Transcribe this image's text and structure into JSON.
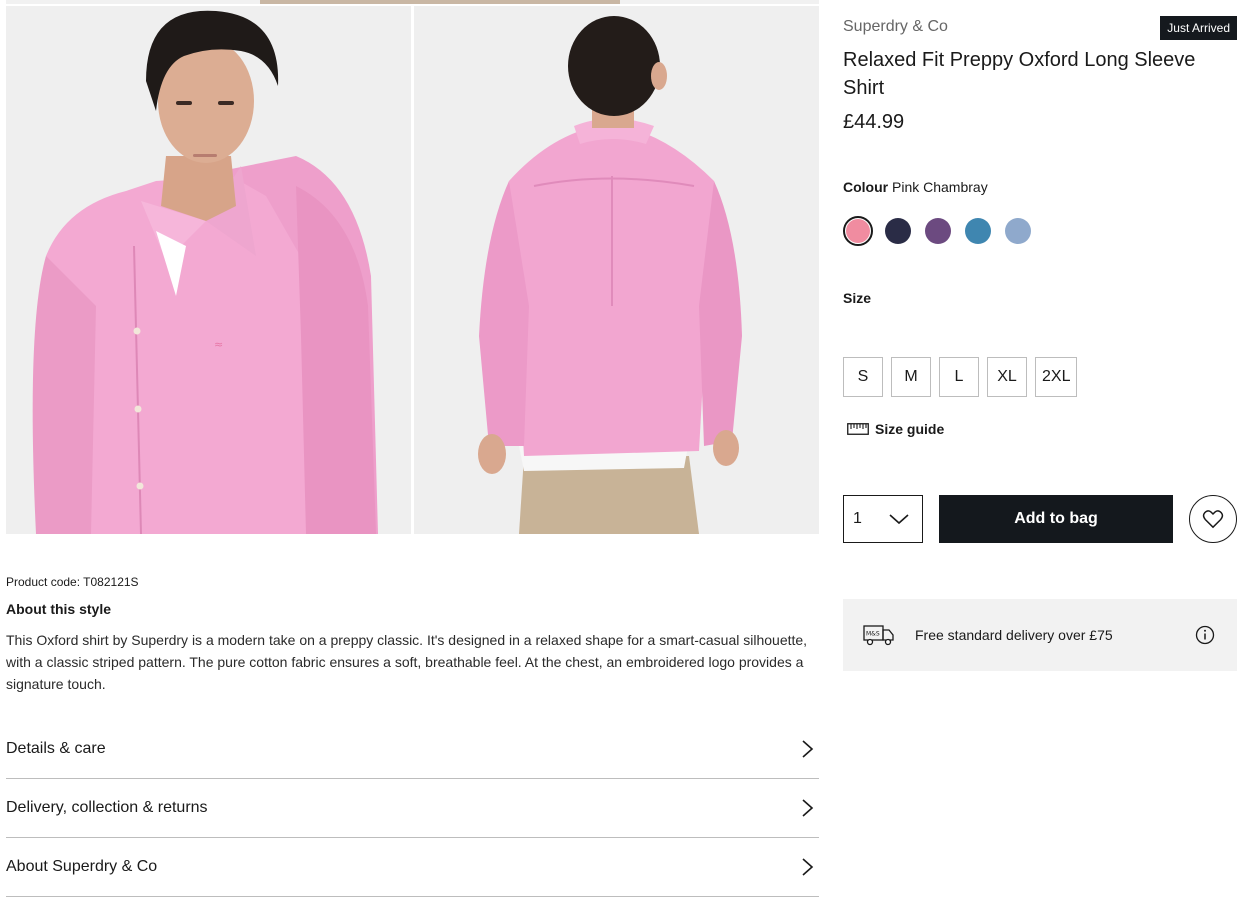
{
  "gallery": {
    "images": [
      {
        "label": "Front view of model wearing pink oxford shirt"
      },
      {
        "label": "Back view of model wearing pink oxford shirt"
      }
    ]
  },
  "product": {
    "brand": "Superdry & Co",
    "badge": "Just Arrived",
    "title": "Relaxed Fit Preppy Oxford Long Sleeve Shirt",
    "price": "£44.99",
    "code": "Product code: T082121S"
  },
  "colour": {
    "label": "Colour",
    "selected": "Pink Chambray",
    "swatches": [
      {
        "color": "#f08ca0",
        "selected": true
      },
      {
        "color": "#2a2c46",
        "selected": false
      },
      {
        "color": "#6c4a80",
        "selected": false
      },
      {
        "color": "#3f86b0",
        "selected": false
      },
      {
        "color": "#8fa9cc",
        "selected": false
      }
    ]
  },
  "size": {
    "label": "Size",
    "options": [
      "S",
      "M",
      "L",
      "XL",
      "2XL"
    ],
    "guide_label": "Size guide"
  },
  "purchase": {
    "quantity": "1",
    "add_label": "Add to bag"
  },
  "delivery": {
    "van_text": "M&S",
    "text": "Free standard delivery over £75"
  },
  "about": {
    "heading": "About this style",
    "text": "This Oxford shirt by Superdry is a modern take on a preppy classic. It's designed in a relaxed shape for a smart-casual silhouette, with a classic striped pattern. The pure cotton fabric ensures a soft, breathable feel. At the chest, an embroidered logo provides a signature touch."
  },
  "accordion": [
    {
      "label": "Details & care"
    },
    {
      "label": "Delivery, collection & returns"
    },
    {
      "label": "About Superdry & Co"
    }
  ],
  "colors": {
    "primary_button": "#14181d",
    "badge": "#15191e",
    "delivery_bg": "#f2f2f2",
    "border": "#bdbdbd"
  }
}
